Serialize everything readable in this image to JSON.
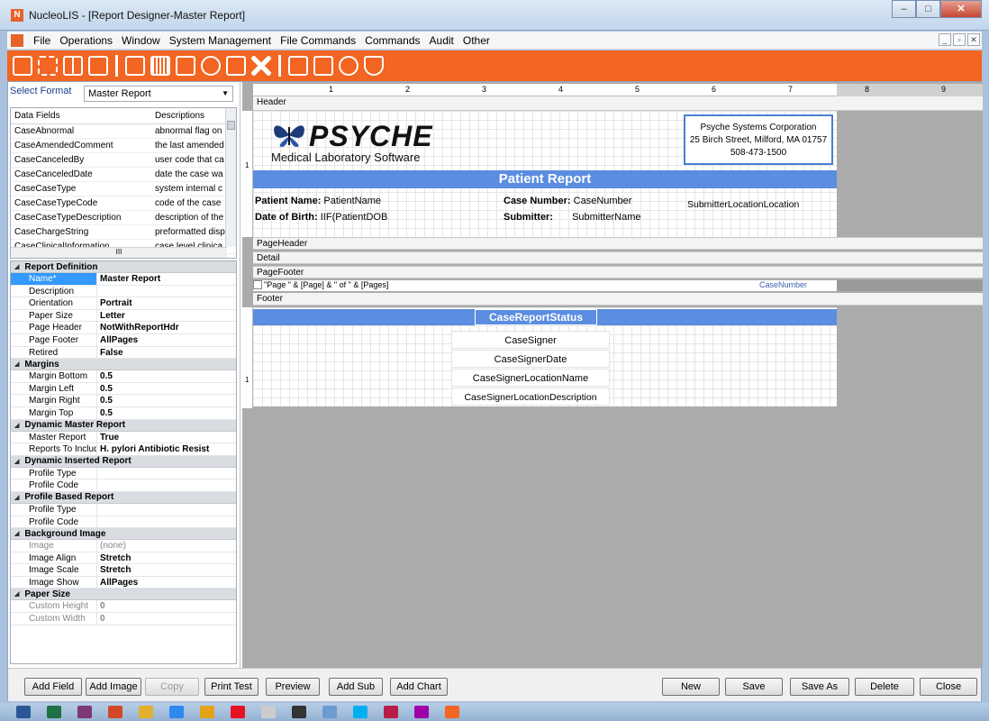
{
  "window": {
    "title": "NucleoLIS - [Report Designer-Master Report]",
    "app_icon": "nucleolis-app-icon",
    "controls": [
      "minimize-icon",
      "maximize-icon",
      "close-icon"
    ]
  },
  "menu": {
    "items": [
      "File",
      "Operations",
      "Window",
      "System Management",
      "File Commands",
      "Commands",
      "Audit",
      "Other"
    ]
  },
  "toolbar": {
    "accent": "#f26522",
    "icons": [
      "new-case-icon",
      "dna-icon",
      "grid-icon",
      "printer-icon",
      "pen-icon",
      "barcode-icon",
      "clipboard-icon",
      "at-icon",
      "report-icon",
      "tools-icon",
      "chart-icon",
      "calendar-add-icon",
      "dashboard-icon",
      "shield-check-icon"
    ]
  },
  "left": {
    "select_format_label": "Select Format",
    "format_value": "Master Report",
    "fields": {
      "headers": [
        "Data Fields",
        "Descriptions"
      ],
      "rows": [
        [
          "CaseAbnormal",
          "abnormal flag on"
        ],
        [
          "CaseAmendedComment",
          "the last amended"
        ],
        [
          "CaseCanceledBy",
          "user code that ca"
        ],
        [
          "CaseCanceledDate",
          "date the case wa"
        ],
        [
          "CaseCaseType",
          "system internal c"
        ],
        [
          "CaseCaseTypeCode",
          "code of the case"
        ],
        [
          "CaseCaseTypeDescription",
          "description of the"
        ],
        [
          "CaseChargeString",
          "preformatted disp"
        ],
        [
          "CaseClinicalInformation",
          "case level clinica"
        ]
      ]
    },
    "hscroll_mark": "III",
    "properties": [
      {
        "category": "Report Definition",
        "rows": [
          {
            "name": "Name*",
            "value": "Master Report",
            "selected": true
          },
          {
            "name": "Description",
            "value": ""
          },
          {
            "name": "Orientation",
            "value": "Portrait"
          },
          {
            "name": "Paper Size",
            "value": "Letter"
          },
          {
            "name": "Page Header",
            "value": "NotWithReportHdr"
          },
          {
            "name": "Page Footer",
            "value": "AllPages"
          },
          {
            "name": "Retired",
            "value": "False"
          }
        ]
      },
      {
        "category": "Margins",
        "rows": [
          {
            "name": "Margin Bottom",
            "value": "0.5"
          },
          {
            "name": "Margin Left",
            "value": "0.5"
          },
          {
            "name": "Margin Right",
            "value": "0.5"
          },
          {
            "name": "Margin Top",
            "value": "0.5"
          }
        ]
      },
      {
        "category": "Dynamic Master Report",
        "rows": [
          {
            "name": "Master Report",
            "value": "True"
          },
          {
            "name": "Reports To Include",
            "value": "H. pylori Antibiotic Resist"
          }
        ]
      },
      {
        "category": "Dynamic Inserted Report",
        "rows": [
          {
            "name": "Profile Type",
            "value": ""
          },
          {
            "name": "Profile Code",
            "value": ""
          }
        ]
      },
      {
        "category": "Profile Based Report",
        "rows": [
          {
            "name": "Profile Type",
            "value": ""
          },
          {
            "name": "Profile Code",
            "value": ""
          }
        ]
      },
      {
        "category": "Background Image",
        "rows": [
          {
            "name": "Image",
            "value": "(none)",
            "dim": true
          },
          {
            "name": "Image Align",
            "value": "Stretch"
          },
          {
            "name": "Image Scale",
            "value": "Stretch"
          },
          {
            "name": "Image Show",
            "value": "AllPages"
          }
        ]
      },
      {
        "category": "Paper Size",
        "rows": [
          {
            "name": "Custom Height",
            "value": "0",
            "dim": true
          },
          {
            "name": "Custom Width",
            "value": "0",
            "dim": true
          }
        ]
      }
    ]
  },
  "designer": {
    "ruler_marks": [
      "1",
      "2",
      "3",
      "4",
      "5",
      "6",
      "7",
      "8",
      "9"
    ],
    "sections": {
      "header": "Header",
      "page_header": "PageHeader",
      "detail": "Detail",
      "page_footer": "PageFooter",
      "footer": "Footer"
    },
    "vruler_mark": "1",
    "logo": {
      "word": "PSYCHE",
      "sub": "Medical Laboratory Software"
    },
    "address": [
      "Psyche Systems Corporation",
      "25 Birch Street, Milford, MA 01757",
      "508-473-1500"
    ],
    "banner": "Patient Report",
    "fields": {
      "patient_name_label": "Patient Name:",
      "patient_name_value": "PatientName",
      "dob_label": "Date of Birth:",
      "dob_value": "IIF(PatientDOB",
      "case_number_label": "Case Number:",
      "case_number_value": "CaseNumber",
      "submitter_label": "Submitter:",
      "submitter_value": "SubmitterName",
      "submitter_location": "SubmitterLocationLocation"
    },
    "page_footer_expr": "\"Page \" & [Page] & \" of \" & [Pages]",
    "page_footer_casenumber": "CaseNumber",
    "footer": {
      "status": "CaseReportStatus",
      "signer": "CaseSigner",
      "signer_date": "CaseSignerDate",
      "signer_location_name": "CaseSignerLocationName",
      "signer_location_desc": "CaseSignerLocationDescription"
    }
  },
  "buttons": {
    "add_field": "Add Field",
    "add_image": "Add Image",
    "copy": "Copy",
    "print_test": "Print Test",
    "preview": "Preview",
    "add_sub": "Add Sub",
    "add_chart": "Add Chart",
    "new": "New",
    "save": "Save",
    "save_as": "Save As",
    "delete": "Delete",
    "close": "Close"
  },
  "taskbar": {
    "apps": [
      "word-icon",
      "excel-icon",
      "onenote-icon",
      "powerpoint-icon",
      "chrome-icon",
      "ie-icon",
      "explorer-icon",
      "app-s-icon",
      "notepad-icon",
      "terminal-icon",
      "network-icon",
      "skype-icon",
      "reader-icon",
      "media-icon",
      "nucleolis-taskbar-icon"
    ],
    "colors": [
      "#2b5797",
      "#1e7145",
      "#7e3878",
      "#d24726",
      "#e2b12c",
      "#2d89ef",
      "#e3a21a",
      "#e81123",
      "#cccccc",
      "#333333",
      "#6b9bd1",
      "#00aff0",
      "#b91d47",
      "#9f00a7",
      "#f26522"
    ]
  }
}
